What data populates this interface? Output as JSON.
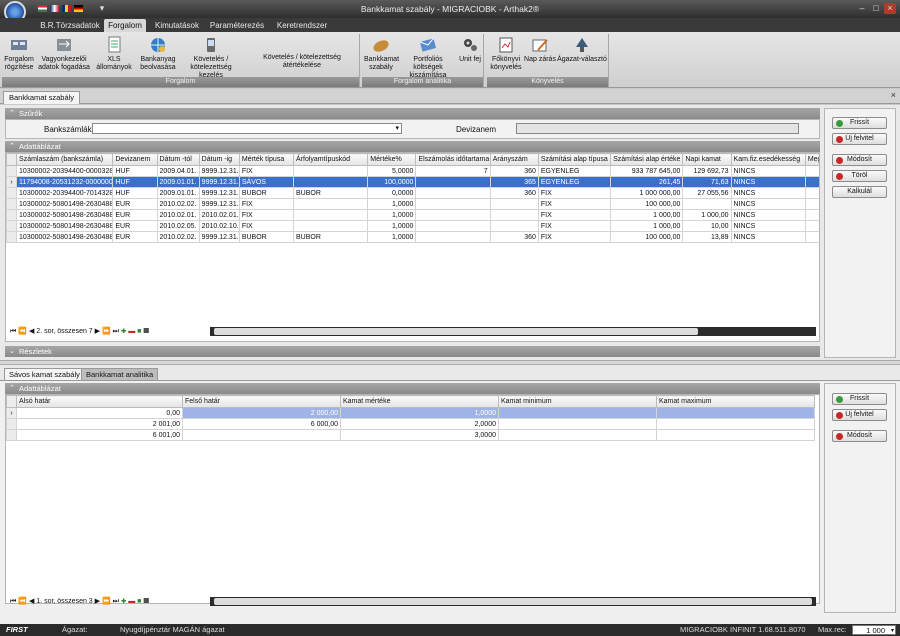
{
  "window": {
    "title": "Bankkamat szabály - MIGRACIOBK - Arthak2®"
  },
  "menu": [
    {
      "label": "B.R.Törzsadatok"
    },
    {
      "label": "Forgalom"
    },
    {
      "label": "Kimutatások"
    },
    {
      "label": "Paraméterezés"
    },
    {
      "label": "Keretrendszer"
    }
  ],
  "ribbon": {
    "groups": [
      {
        "label": "Forgalom",
        "buttons": [
          "Forgalom\nrögzítése",
          "Vagyonkezelői\nadatok fogadása",
          "XLS állományok",
          "Bankanyag\nbeolvasása",
          "Követelés /\nkötelezettség kezelés",
          "Követelés / kötelezettség átértékelése"
        ]
      },
      {
        "label": "Forgalom analitika",
        "buttons": [
          "Bankkamat\nszabály",
          "Portfoliós költségek\nkiszámítása",
          "Unit fej"
        ]
      },
      {
        "label": "Könyvelés",
        "buttons": [
          "Főkönyvi\nkönyvelés",
          "Nap zárás",
          "Ágazat-választó"
        ]
      }
    ]
  },
  "doc_tab": "Bankkamat szabály",
  "filters": {
    "header": "Szűrők",
    "bankszamlak_label": "Bankszámlák",
    "bankszamlak_value": "",
    "devizanem_label": "Devizanem",
    "devizanem_value": ""
  },
  "top_grid": {
    "header": "Adattáblázat",
    "columns": [
      "Számlaszám (bankszámla)",
      "Devizanem",
      "Dátum -tól",
      "Dátum -ig",
      "Mérték típusa",
      "Árfolyamtípuskód",
      "Mértéke%",
      "Elszámolás időtartama",
      "Arányszám",
      "Számítási alap típusa",
      "Számítási alap értéke",
      "Napi kamat",
      "Kam.fiz.esedékesség",
      "Meg"
    ],
    "rows": [
      [
        "10300002-20394400-00003285",
        "HUF",
        "2009.04.01.",
        "9999.12.31.",
        "FIX",
        "",
        "5,0000",
        "7",
        "360",
        "EGYENLEG",
        "933 787 645,00",
        "129 692,73",
        "NINCS",
        ""
      ],
      [
        "11794008-20531232-00000000",
        "HUF",
        "2009.01.01.",
        "9999.12.31.",
        "SÁVOS",
        "",
        "100,0000",
        "",
        "365",
        "EGYENLEG",
        "261,45",
        "71,63",
        "NINCS",
        ""
      ],
      [
        "10300002-20394400-70143285",
        "HUF",
        "2009.01.01.",
        "9999.12.31.",
        "BUBOR",
        "BUBOR",
        "0,0000",
        "",
        "360",
        "FIX",
        "1 000 000,00",
        "27 055,56",
        "NINCS",
        ""
      ],
      [
        "10300002-50801498-26304884",
        "EUR",
        "2010.02.02.",
        "9999.12.31.",
        "FIX",
        "",
        "1,0000",
        "",
        "",
        "FIX",
        "100 000,00",
        "",
        "NINCS",
        ""
      ],
      [
        "10300002-50801498-26304884",
        "EUR",
        "2010.02.01.",
        "2010.02.01.",
        "FIX",
        "",
        "1,0000",
        "",
        "",
        "FIX",
        "1 000,00",
        "1 000,00",
        "NINCS",
        ""
      ],
      [
        "10300002-50801498-26304884",
        "EUR",
        "2010.02.05.",
        "2010.02.10.",
        "FIX",
        "",
        "1,0000",
        "",
        "",
        "FIX",
        "1 000,00",
        "10,00",
        "NINCS",
        ""
      ],
      [
        "10300002-50801498-26304884",
        "EUR",
        "2010.02.02.",
        "9999.12.31.",
        "BUBOR",
        "BUBOR",
        "1,0000",
        "",
        "360",
        "FIX",
        "100 000,00",
        "13,89",
        "NINCS",
        ""
      ]
    ],
    "selected_row": 1,
    "nav_text": "2. sor, összesen 7"
  },
  "top_buttons": [
    "Frissít",
    "Új felvitel",
    "Módosít",
    "Töröl",
    "Kalkulál"
  ],
  "details_header": "Részletek",
  "sub_tabs": [
    "Sávos kamat szabály",
    "Bankkamat analitika"
  ],
  "bottom_grid": {
    "header": "Adattáblázat",
    "columns": [
      "Alsó határ",
      "Felső határ",
      "Kamat mértéke",
      "Kamat minimum",
      "Kamat maximum"
    ],
    "rows": [
      [
        "0,00",
        "2 000,00",
        "1,0000",
        "",
        ""
      ],
      [
        "2 001,00",
        "6 000,00",
        "2,0000",
        "",
        ""
      ],
      [
        "6 001,00",
        "",
        "3,0000",
        "",
        ""
      ]
    ],
    "selected_row": 0,
    "nav_text": "1. sor, összesen 3"
  },
  "bottom_buttons": [
    "Frissít",
    "Új felvitel",
    "Módosít"
  ],
  "status": {
    "brand": "FIRST",
    "agazat_label": "Ágazat:",
    "agazat_value": "Nyugdíjpénztár MAGÁN ágazat",
    "server": "MIGRACIOBK  INFINIT  1.68.511.8070",
    "maxrec_label": "Max.rec:",
    "maxrec_value": "1 000"
  },
  "colors": {
    "accent": "#3b6fcc",
    "titlebar": "#2e2e2e",
    "panel_header": "#8a8a8a"
  }
}
